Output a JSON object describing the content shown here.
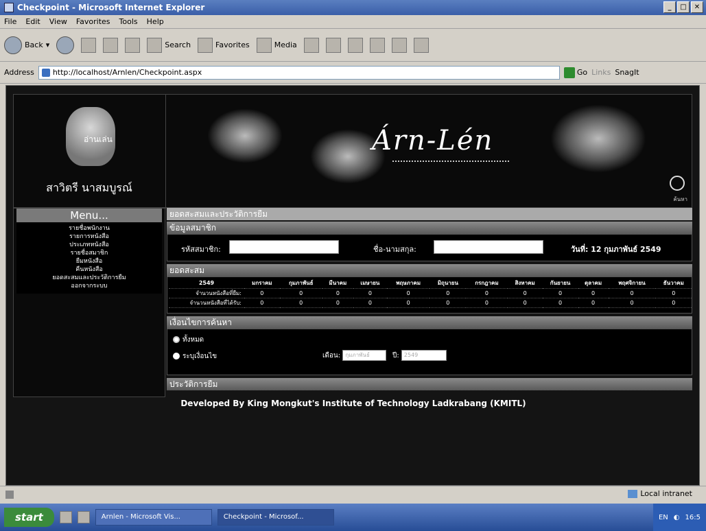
{
  "window": {
    "title": "Checkpoint - Microsoft Internet Explorer"
  },
  "menubar": {
    "items": [
      "File",
      "Edit",
      "View",
      "Favorites",
      "Tools",
      "Help"
    ]
  },
  "toolbar": {
    "back_label": "Back",
    "search_label": "Search",
    "favorites_label": "Favorites",
    "media_label": "Media"
  },
  "addressbar": {
    "label": "Address",
    "url": "http://localhost/Arnlen/Checkpoint.aspx",
    "go_label": "Go",
    "links_label": "Links",
    "snagit_label": "SnagIt"
  },
  "page": {
    "username": "สาวิตรี นาสมบูรณ์",
    "teddy_label": "อ่านเล่น",
    "banner_title": "Árn-Lén",
    "search_caption": "ค้นหา",
    "menu_title": "Menu...",
    "menu_items": [
      "รายชื่อพนักงาน",
      "รายการหนังสือ",
      "ประเภทหนังสือ",
      "รายชื่อสมาชิก",
      "ยืมหนังสือ",
      "คืนหนังสือ",
      "ยอดสะสมและประวัติการยืม",
      "ออกจากระบบ"
    ],
    "top_bar": "ยอดสะสมและประวัติการยืม",
    "member_bar": "ข้อมูลสมาชิก",
    "member_id_label": "รหัสสมาชิก:",
    "member_name_label": "ชื่อ-นามสกุล:",
    "date_label": "วันที่: 12 กุมภาพันธ์ 2549",
    "accum_bar": "ยอดสะสม",
    "year": "2549",
    "months": [
      "มกราคม",
      "กุมภาพันธ์",
      "มีนาคม",
      "เมษายน",
      "พฤษภาคม",
      "มิถุนายน",
      "กรกฎาคม",
      "สิงหาคม",
      "กันยายน",
      "ตุลาคม",
      "พฤศจิกายน",
      "ธันวาคม"
    ],
    "row1_label": "จำนวนหนังสือที่ยืม:",
    "row2_label": "จำนวนหนังสือที่ได้รับ:",
    "row1_values": [
      "0",
      "0",
      "0",
      "0",
      "0",
      "0",
      "0",
      "0",
      "0",
      "0",
      "0",
      "0"
    ],
    "row2_values": [
      "0",
      "0",
      "0",
      "0",
      "0",
      "0",
      "0",
      "0",
      "0",
      "0",
      "0",
      "0"
    ],
    "search_cond_bar": "เงื่อนไขการค้นหา",
    "radio_all": "ทั้งหมด",
    "radio_specify": "ระบุเงื่อนไข",
    "month_label": "เดือน:",
    "month_value": "กุมภาพันธ์",
    "year_label": "ปี:",
    "year_value": "2549",
    "history_bar": "ประวัติการยืม",
    "footer": "Developed By King Mongkut's Institute of Technology Ladkrabang (KMITL)"
  },
  "statusbar": {
    "zone": "Local intranet"
  },
  "taskbar": {
    "start": "start",
    "tasks": [
      "Arnlen - Microsoft Vis...",
      "Checkpoint - Microsof..."
    ],
    "lang": "EN",
    "clock": "16:5"
  }
}
